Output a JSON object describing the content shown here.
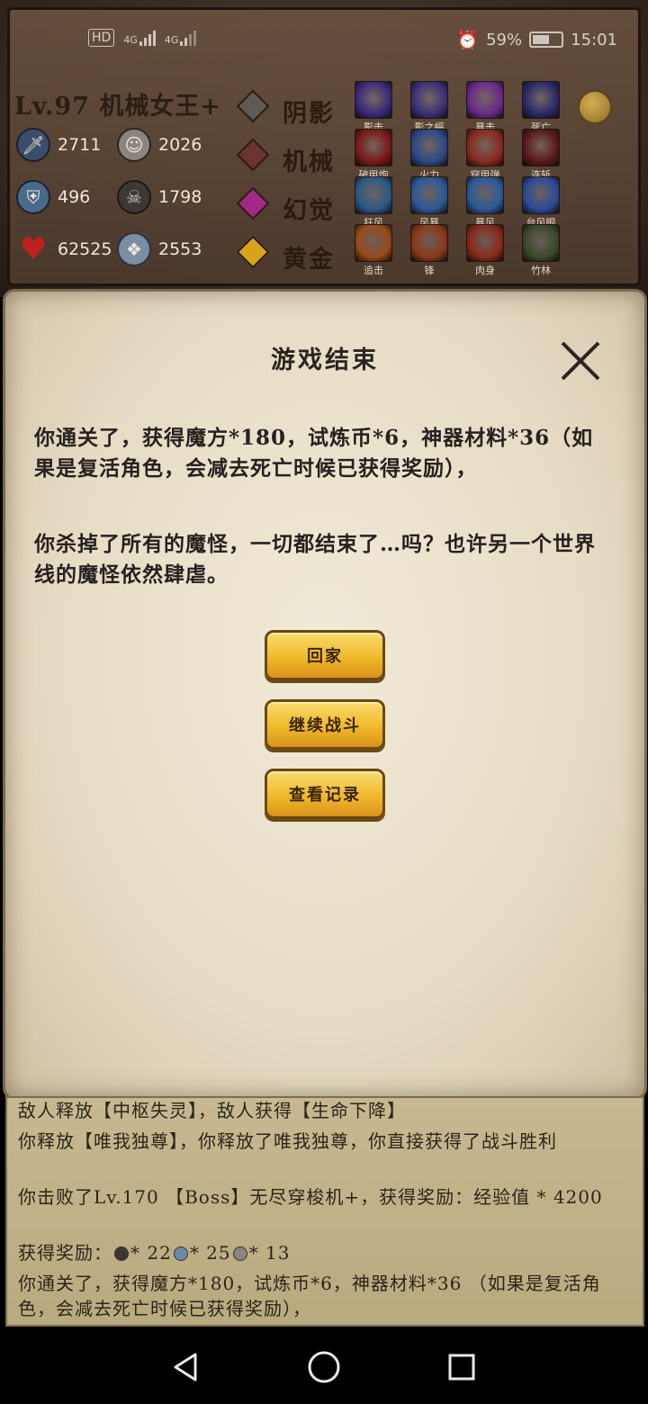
{
  "status_bar": {
    "network": "HD",
    "sim1": "4G",
    "sim2": "4G",
    "battery": "59%",
    "battery_level": 0.59,
    "time": "15:01"
  },
  "player": {
    "title": "Lv.97 机械女王+",
    "stats": [
      {
        "icon": "sword-icon",
        "value": "2711"
      },
      {
        "icon": "shield-icon",
        "value": "496"
      },
      {
        "icon": "heart-icon",
        "value": "62525"
      },
      {
        "icon": "stone-face-icon",
        "value": "2026"
      },
      {
        "icon": "skull-icon",
        "value": "1798"
      },
      {
        "icon": "crystal-icon",
        "value": "2553"
      }
    ],
    "elements": [
      {
        "label": "阴影",
        "color": "#5e5a56"
      },
      {
        "label": "机械",
        "color": "#6a3430"
      },
      {
        "label": "幻觉",
        "color": "#a02a86"
      },
      {
        "label": "黄金",
        "color": "#d9a21c"
      }
    ],
    "skills": [
      {
        "label": "影击",
        "color": "#3a2a7a"
      },
      {
        "label": "影之蝠",
        "color": "#3a3078"
      },
      {
        "label": "暴击",
        "color": "#6a2a8a"
      },
      {
        "label": "死亡",
        "color": "#2a2a6a"
      },
      {
        "label": "破甲炮",
        "color": "#7a1a18"
      },
      {
        "label": "火力",
        "color": "#2a4a8a"
      },
      {
        "label": "穿甲弹",
        "color": "#8a2a20"
      },
      {
        "label": "连斩",
        "color": "#5a1a1a"
      },
      {
        "label": "狂风",
        "color": "#2a5a8a"
      },
      {
        "label": "风暴",
        "color": "#2a5a9a"
      },
      {
        "label": "暴风",
        "color": "#2a5a9a"
      },
      {
        "label": "台风眼",
        "color": "#2a4a9a"
      },
      {
        "label": "追击",
        "color": "#9a4a1a"
      },
      {
        "label": "锋",
        "color": "#8a3a1a"
      },
      {
        "label": "肉身",
        "color": "#8a2a1a"
      },
      {
        "label": "竹林",
        "color": "#3a4a2a"
      }
    ]
  },
  "dialog": {
    "title": "游戏结束",
    "paragraph1": "你通关了，获得魔方*180，试炼币*6，神器材料*36（如果是复活角色，会减去死亡时候已获得奖励），",
    "paragraph2": "你杀掉了所有的魔怪，一切都结束了…吗？也许另一个世界线的魔怪依然肆虐。",
    "buttons": {
      "home": "回家",
      "continue": "继续战斗",
      "records": "查看记录"
    }
  },
  "battle_log": {
    "line1": "敌人释放【中枢失灵】，敌人获得【生命下降】",
    "line2": "你释放【唯我独尊】，你释放了唯我独尊，你直接获得了战斗胜利",
    "line3": "你击败了Lv.170 【Boss】无尽穿梭机+，获得奖励：经验值 * 4200",
    "reward_label": "获得奖励：",
    "reward1": "* 22",
    "reward2": "* 25",
    "reward3": "* 13",
    "line5": "你通关了，获得魔方*180，试炼币*6，神器材料*36 （如果是复活角色，会减去死亡时候已获得奖励），"
  },
  "navbar": {
    "back": "back-icon",
    "home": "home-icon",
    "recents": "recents-icon"
  }
}
